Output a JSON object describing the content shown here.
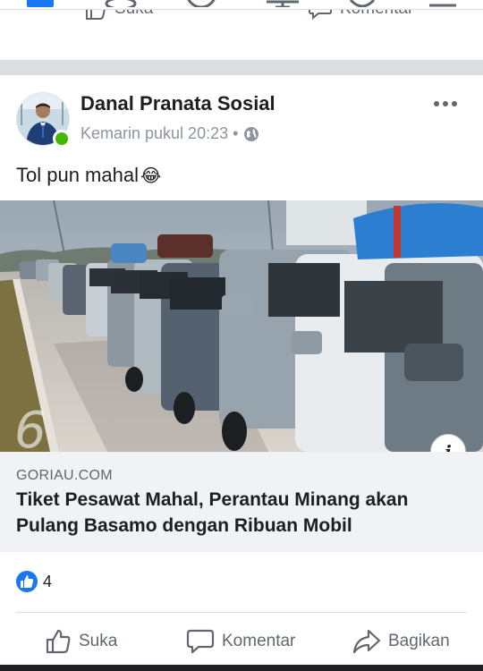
{
  "top_nav": {
    "icons": [
      "home-icon",
      "friends-icon",
      "messenger-icon",
      "watch-icon",
      "notifications-icon",
      "menu-icon"
    ]
  },
  "previous_post": {
    "like_label": "Suka",
    "comment_label": "Komentar"
  },
  "post": {
    "author": "Danal Pranata Sosial",
    "timestamp": "Kemarin pukul 20:23 •",
    "privacy_icon": "public-globe-icon",
    "message": "Tol pun mahal",
    "message_emoji": "😂",
    "link": {
      "domain": "GORIAU.COM",
      "headline": "Tiket Pesawat Mahal, Perantau Minang akan Pulang Basamo dengan Ribuan Mobil",
      "watermark": "6"
    },
    "reactions": {
      "count": "4",
      "icon": "like-reaction-icon"
    },
    "actions": {
      "like_label": "Suka",
      "comment_label": "Komentar",
      "share_label": "Bagikan"
    }
  },
  "colors": {
    "brand_blue": "#1877f2",
    "online_green": "#44b700",
    "secondary_text": "#606770",
    "card_background": "#f0f2f5",
    "separator": "#dadde1"
  }
}
